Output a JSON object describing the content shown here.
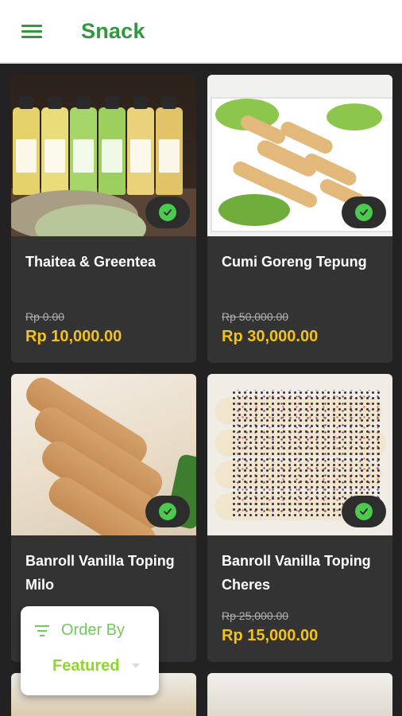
{
  "app_bar": {
    "title": "Snack",
    "menu_icon": "hamburger-menu-icon",
    "accent_color": "#2e9a3c"
  },
  "products": [
    {
      "name": "Thaitea & Greentea",
      "original_price": "Rp 0.00",
      "price": "Rp 10,000.00",
      "available": true
    },
    {
      "name": "Cumi Goreng Tepung",
      "original_price": "Rp 50,000.00",
      "price": "Rp 30,000.00",
      "available": true
    },
    {
      "name": "Banroll Vanilla Toping Milo",
      "original_price": "",
      "price": "",
      "available": true
    },
    {
      "name": "Banroll Vanilla Toping Cheres",
      "original_price": "Rp 25,000.00",
      "price": "Rp 15,000.00",
      "available": true
    }
  ],
  "order_by": {
    "label": "Order By",
    "selected": "Featured",
    "icon": "filter-list-icon"
  },
  "colors": {
    "background": "#222222",
    "card": "#333333",
    "price": "#f2c21b",
    "check_badge": "#4cc94f"
  }
}
